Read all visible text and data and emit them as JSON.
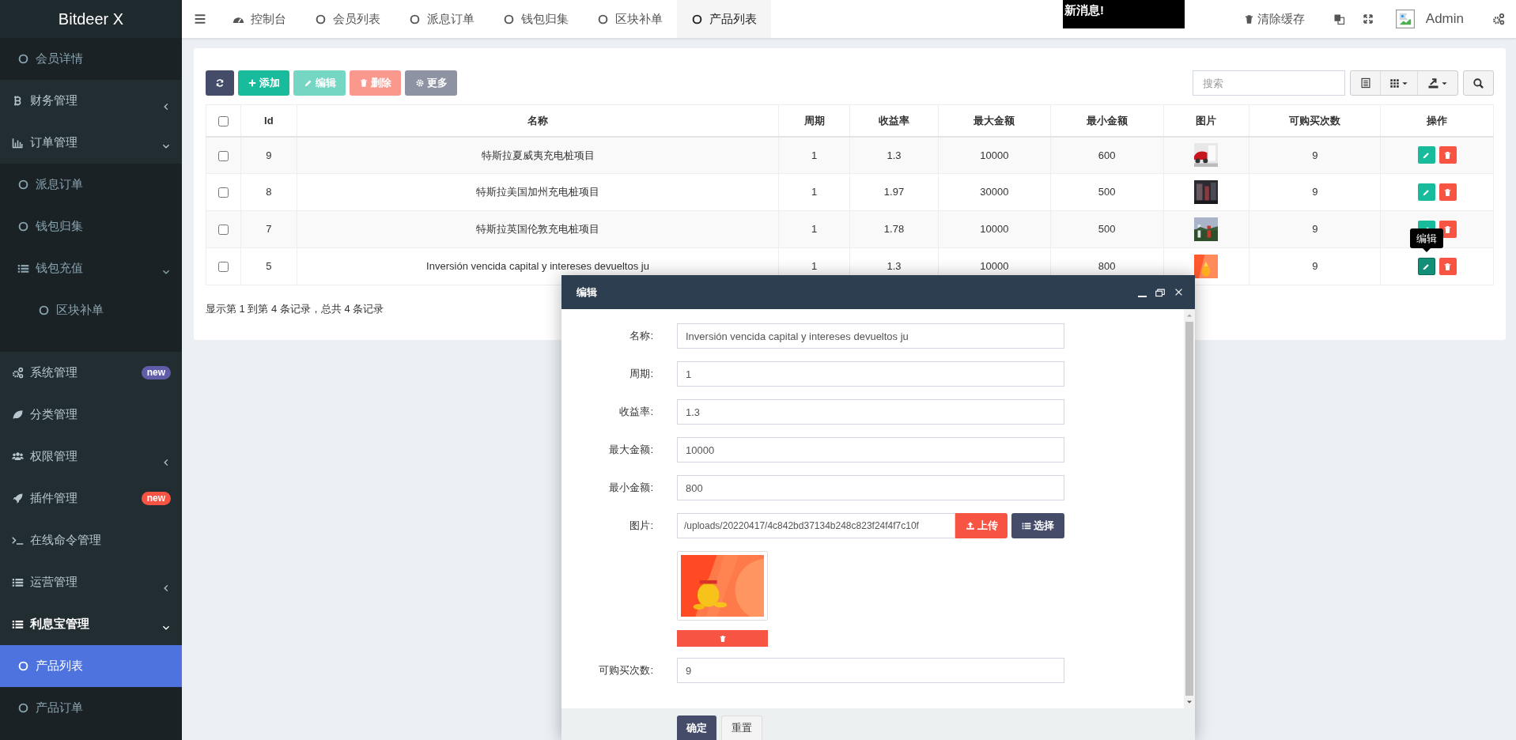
{
  "app": {
    "title": "Bitdeer X"
  },
  "sidebar": {
    "items": [
      {
        "kind": "submenu",
        "children": [
          {
            "label": "会员详情",
            "selected": false
          }
        ]
      },
      {
        "label": "财务管理",
        "selected": false,
        "expanded": false
      },
      {
        "label": "订单管理",
        "selected": false,
        "expanded": true,
        "children": [
          {
            "label": "派息订单",
            "selected": false
          },
          {
            "label": "钱包归集",
            "selected": false
          },
          {
            "label": "钱包充值",
            "selected": false,
            "expanded": true,
            "children": [
              {
                "label": "区块补单",
                "selected": false
              }
            ]
          }
        ]
      },
      {
        "label": "系统管理",
        "selected": false,
        "badge": "new",
        "color": "#605ca8"
      },
      {
        "label": "分类管理",
        "selected": false
      },
      {
        "label": "权限管理",
        "selected": false,
        "expanded": false
      },
      {
        "label": "插件管理",
        "selected": false,
        "badge": "new",
        "color": "#f75444"
      },
      {
        "label": "在线命令管理",
        "selected": false
      },
      {
        "label": "运营管理",
        "selected": false,
        "expanded": false
      },
      {
        "label": "利息宝管理",
        "selected": true,
        "expanded": true,
        "children": [
          {
            "label": "产品列表",
            "selected": true
          },
          {
            "label": "产品订单",
            "selected": false
          }
        ]
      }
    ]
  },
  "topbar": {
    "tabs": [
      {
        "label": "控制台",
        "kind": "dashboard",
        "selected": false
      },
      {
        "label": "会员列表",
        "kind": "page",
        "selected": false
      },
      {
        "label": "派息订单",
        "kind": "page",
        "selected": false
      },
      {
        "label": "钱包归集",
        "kind": "page",
        "selected": false
      },
      {
        "label": "区块补单",
        "kind": "page",
        "selected": false
      },
      {
        "label": "产品列表",
        "kind": "page",
        "selected": true
      }
    ],
    "notice": "新消息!",
    "clear_cache": "清除缓存",
    "user": "Admin"
  },
  "panel": {
    "toolbar": [
      {
        "kind": "refresh",
        "disabled": false
      },
      {
        "kind": "add",
        "label": "添加",
        "disabled": false
      },
      {
        "kind": "edit",
        "label": "编辑",
        "disabled": true
      },
      {
        "kind": "delete",
        "label": "删除",
        "disabled": true
      },
      {
        "kind": "more",
        "label": "更多",
        "disabled": true
      }
    ],
    "search": {
      "placeholder": "搜索"
    },
    "table": {
      "header_checked": false,
      "columns": [
        "Id",
        "名称",
        "周期",
        "收益率",
        "最大金额",
        "最小金额",
        "图片",
        "可购买次数",
        "操作"
      ],
      "rows": [
        {
          "checked": false,
          "id": "9",
          "name": "特斯拉夏威夷充电桩项目",
          "period": "1",
          "rate": "1.3",
          "max": "10000",
          "min": "600",
          "count": "9",
          "edit_hovered": false
        },
        {
          "checked": false,
          "id": "8",
          "name": "特斯拉美国加州充电桩项目",
          "period": "1",
          "rate": "1.97",
          "max": "30000",
          "min": "500",
          "count": "9",
          "edit_hovered": false
        },
        {
          "checked": false,
          "id": "7",
          "name": "特斯拉英国伦敦充电桩项目",
          "period": "1",
          "rate": "1.78",
          "max": "10000",
          "min": "500",
          "count": "9",
          "edit_hovered": false
        },
        {
          "checked": false,
          "id": "5",
          "name": "Inversión vencida capital y intereses devueltos ju",
          "period": "1",
          "rate": "1.3",
          "max": "10000",
          "min": "800",
          "count": "9",
          "edit_hovered": true
        }
      ]
    },
    "tooltip": "编辑",
    "footer": "显示第 1 到第 4 条记录，总共 4 条记录"
  },
  "dialog": {
    "title": "编辑",
    "fields": [
      {
        "kind": "text",
        "label": "名称:",
        "value": "Inversión vencida capital y intereses devueltos ju"
      },
      {
        "kind": "text",
        "label": "周期:",
        "value": "1"
      },
      {
        "kind": "text",
        "label": "收益率:",
        "value": "1.3"
      },
      {
        "kind": "text",
        "label": "最大金额:",
        "value": "10000"
      },
      {
        "kind": "text",
        "label": "最小金额:",
        "value": "800"
      },
      {
        "label": "图片:",
        "value": "/uploads/20220417/4c842bd37134b248c823f24f4f7c10f",
        "upload": "上传",
        "choose": "选择"
      },
      {
        "kind": "text",
        "label": "可购买次数:",
        "value": "9"
      }
    ],
    "buttons": [
      {
        "kind": "primary",
        "label": "确定"
      },
      {
        "kind": "default",
        "label": "重置"
      }
    ]
  }
}
